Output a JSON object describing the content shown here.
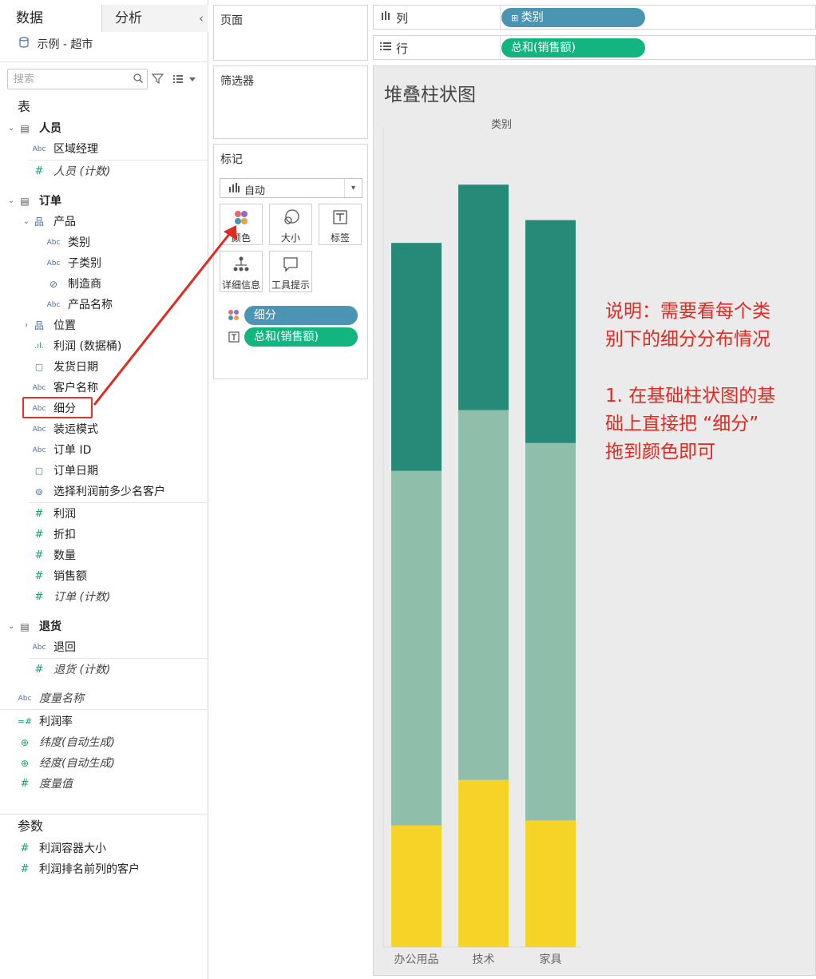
{
  "left_pane": {
    "tabs": {
      "data": "数据",
      "analysis": "分析"
    },
    "datasource": "示例 - 超市",
    "search": {
      "placeholder": "搜索"
    },
    "tables_title": "表",
    "fields": [
      {
        "id": "f-renyuan",
        "label": "人员",
        "icon": "table",
        "bold": true,
        "italic": false,
        "indent": 0,
        "expand": "open"
      },
      {
        "id": "f-quyujingli",
        "label": "区域经理",
        "icon": "abc",
        "bold": false,
        "italic": false,
        "indent": 1,
        "expand": ""
      },
      {
        "id": "f-renyuan-count",
        "label": "人员 (计数)",
        "icon": "number",
        "bold": false,
        "italic": true,
        "indent": 1,
        "expand": ""
      },
      {
        "id": "f-dingdan",
        "label": "订单",
        "icon": "table",
        "bold": true,
        "italic": false,
        "indent": 0,
        "expand": "open"
      },
      {
        "id": "f-chanpin",
        "label": "产品",
        "icon": "hierarchy",
        "bold": false,
        "italic": false,
        "indent": 1,
        "expand": "open"
      },
      {
        "id": "f-leibie",
        "label": "类别",
        "icon": "abc",
        "bold": false,
        "italic": false,
        "indent": 2,
        "expand": ""
      },
      {
        "id": "f-zileibie",
        "label": "子类别",
        "icon": "abc",
        "bold": false,
        "italic": false,
        "indent": 2,
        "expand": ""
      },
      {
        "id": "f-zhizaoshang",
        "label": "制造商",
        "icon": "clip",
        "bold": false,
        "italic": false,
        "indent": 2,
        "expand": ""
      },
      {
        "id": "f-chanpinmingcheng",
        "label": "产品名称",
        "icon": "abc",
        "bold": false,
        "italic": false,
        "indent": 2,
        "expand": ""
      },
      {
        "id": "f-weizhi",
        "label": "位置",
        "icon": "hierarchy",
        "bold": false,
        "italic": false,
        "indent": 1,
        "expand": "closed"
      },
      {
        "id": "f-lirun-bin",
        "label": "利润 (数据桶)",
        "icon": "bin",
        "bold": false,
        "italic": false,
        "indent": 1,
        "expand": ""
      },
      {
        "id": "f-fahuoriqi",
        "label": "发货日期",
        "icon": "date",
        "bold": false,
        "italic": false,
        "indent": 1,
        "expand": ""
      },
      {
        "id": "f-kehumingcheng",
        "label": "客户名称",
        "icon": "abc",
        "bold": false,
        "italic": false,
        "indent": 1,
        "expand": ""
      },
      {
        "id": "f-xifen",
        "label": "细分",
        "icon": "abc",
        "bold": false,
        "italic": false,
        "indent": 1,
        "expand": ""
      },
      {
        "id": "f-zhuangyunmoshi",
        "label": "装运模式",
        "icon": "abc",
        "bold": false,
        "italic": false,
        "indent": 1,
        "expand": ""
      },
      {
        "id": "f-dingdan-id",
        "label": "订单 ID",
        "icon": "abc",
        "bold": false,
        "italic": false,
        "indent": 1,
        "expand": ""
      },
      {
        "id": "f-dingdanriqi",
        "label": "订单日期",
        "icon": "date",
        "bold": false,
        "italic": false,
        "indent": 1,
        "expand": ""
      },
      {
        "id": "f-xuanze",
        "label": "选择利润前多少名客户",
        "icon": "set",
        "bold": false,
        "italic": false,
        "indent": 1,
        "expand": ""
      },
      {
        "id": "f-lirun",
        "label": "利润",
        "icon": "number",
        "bold": false,
        "italic": false,
        "indent": 1,
        "expand": ""
      },
      {
        "id": "f-zhekou",
        "label": "折扣",
        "icon": "number",
        "bold": false,
        "italic": false,
        "indent": 1,
        "expand": ""
      },
      {
        "id": "f-shuliang",
        "label": "数量",
        "icon": "number",
        "bold": false,
        "italic": false,
        "indent": 1,
        "expand": ""
      },
      {
        "id": "f-xiaoshoue",
        "label": "销售额",
        "icon": "number",
        "bold": false,
        "italic": false,
        "indent": 1,
        "expand": ""
      },
      {
        "id": "f-dingdan-count",
        "label": "订单 (计数)",
        "icon": "number",
        "bold": false,
        "italic": true,
        "indent": 1,
        "expand": ""
      },
      {
        "id": "f-tuihuo",
        "label": "退货",
        "icon": "table",
        "bold": true,
        "italic": false,
        "indent": 0,
        "expand": "open"
      },
      {
        "id": "f-tuihui",
        "label": "退回",
        "icon": "abc",
        "bold": false,
        "italic": false,
        "indent": 1,
        "expand": ""
      },
      {
        "id": "f-tuihuo-count",
        "label": "退货 (计数)",
        "icon": "number",
        "bold": false,
        "italic": true,
        "indent": 1,
        "expand": ""
      },
      {
        "id": "f-duliangmingcheng",
        "label": "度量名称",
        "icon": "abc",
        "bold": false,
        "italic": true,
        "indent": -1,
        "expand": ""
      },
      {
        "id": "f-lirunlv",
        "label": "利润率",
        "icon": "calc",
        "bold": false,
        "italic": false,
        "indent": -1,
        "expand": ""
      },
      {
        "id": "f-weidu",
        "label": "纬度(自动生成)",
        "icon": "geo",
        "bold": false,
        "italic": true,
        "indent": -1,
        "expand": ""
      },
      {
        "id": "f-jingdu",
        "label": "经度(自动生成)",
        "icon": "geo",
        "bold": false,
        "italic": true,
        "indent": -1,
        "expand": ""
      },
      {
        "id": "f-duliangzhi",
        "label": "度量值",
        "icon": "number",
        "bold": false,
        "italic": true,
        "indent": -1,
        "expand": ""
      }
    ],
    "parameters_title": "参数",
    "parameters": [
      {
        "id": "p-rongqi",
        "label": "利润容器大小",
        "icon": "number"
      },
      {
        "id": "p-paiming",
        "label": "利润排名前列的客户",
        "icon": "number"
      }
    ]
  },
  "shelves": {
    "pages_title": "页面",
    "filters_title": "筛选器",
    "marks_title": "标记",
    "mark_type": "自动",
    "mark_buttons": [
      {
        "id": "color",
        "label": "颜色"
      },
      {
        "id": "size",
        "label": "大小"
      },
      {
        "id": "label",
        "label": "标签"
      },
      {
        "id": "detail",
        "label": "详细信息"
      },
      {
        "id": "tooltip",
        "label": "工具提示"
      }
    ],
    "mark_pills": [
      {
        "label": "细分",
        "color": "#4c94b3",
        "icon": "color"
      },
      {
        "label": "总和(销售额)",
        "color": "#12b57f",
        "icon": "label"
      }
    ],
    "columns_label": "列",
    "rows_label": "行",
    "columns_pill": "类别",
    "rows_pill": "总和(销售额)"
  },
  "view": {
    "title": "堆叠柱状图",
    "annotation": {
      "line1": "说明：需要看每个类",
      "line2": "别下的细分分布情况",
      "line3": "1. 在基础柱状图的基",
      "line4": "础上直接把 “细分”",
      "line5": "拖到颜色即可"
    }
  },
  "colors": {
    "accent_blue": "#4c94b3",
    "accent_green": "#12b57f",
    "annotation_red": "#e02a22"
  },
  "chart_data": {
    "type": "bar",
    "stacked": true,
    "header": "类别",
    "categories": [
      "办公用品",
      "技术",
      "家具"
    ],
    "series": [
      {
        "color": "#f5d327",
        "values": [
          0.48,
          0.66,
          0.5
        ]
      },
      {
        "color": "#8fbfaa",
        "values": [
          1.4,
          1.46,
          1.49
        ]
      },
      {
        "color": "#278a78",
        "values": [
          0.9,
          0.89,
          0.88
        ]
      }
    ],
    "ylim": [
      0,
      3.2
    ],
    "grid": false
  }
}
